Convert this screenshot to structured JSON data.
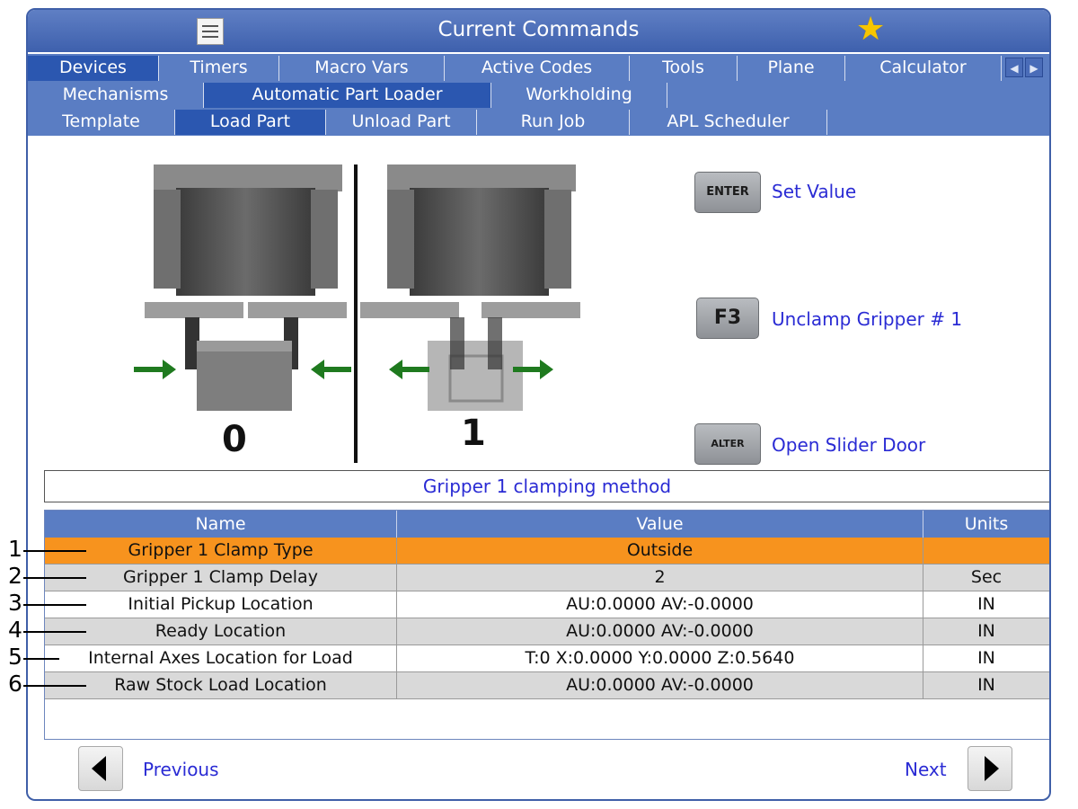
{
  "window": {
    "title": "Current Commands"
  },
  "tabs_row1": [
    "Devices",
    "Timers",
    "Macro Vars",
    "Active Codes",
    "Tools",
    "Plane",
    "Calculator"
  ],
  "tabs_row2": [
    "Mechanisms",
    "Automatic Part Loader",
    "Workholding"
  ],
  "tabs_row3": [
    "Template",
    "Load Part",
    "Unload Part",
    "Run Job",
    "APL Scheduler"
  ],
  "graphic": {
    "left_label": "0",
    "right_label": "1"
  },
  "keys": [
    {
      "key": "ENTER",
      "label": "Set Value"
    },
    {
      "key": "F3",
      "label": "Unclamp Gripper # 1"
    },
    {
      "key": "ALTER",
      "label": "Open Slider Door"
    }
  ],
  "hint": "Gripper 1 clamping method",
  "table": {
    "headers": [
      "Name",
      "Value",
      "Units"
    ],
    "rows": [
      {
        "name": "Gripper 1 Clamp Type",
        "value": "Outside",
        "units": ""
      },
      {
        "name": "Gripper 1 Clamp Delay",
        "value": "2",
        "units": "Sec"
      },
      {
        "name": "Initial Pickup Location",
        "value": "AU:0.0000 AV:-0.0000",
        "units": "IN"
      },
      {
        "name": "Ready Location",
        "value": "AU:0.0000 AV:-0.0000",
        "units": "IN"
      },
      {
        "name": "Internal Axes Location for Load",
        "value": "T:0 X:0.0000 Y:0.0000 Z:0.5640",
        "units": "IN"
      },
      {
        "name": "Raw Stock Load Location",
        "value": "AU:0.0000 AV:-0.0000",
        "units": "IN"
      }
    ]
  },
  "callouts": [
    "1",
    "2",
    "3",
    "4",
    "5",
    "6"
  ],
  "nav": {
    "previous": "Previous",
    "next": "Next"
  },
  "colors": {
    "accent_blue": "#5a7dc3",
    "active_tab": "#2b57b0",
    "selected_row": "#f7931e",
    "label_blue": "#2a2bd4"
  }
}
